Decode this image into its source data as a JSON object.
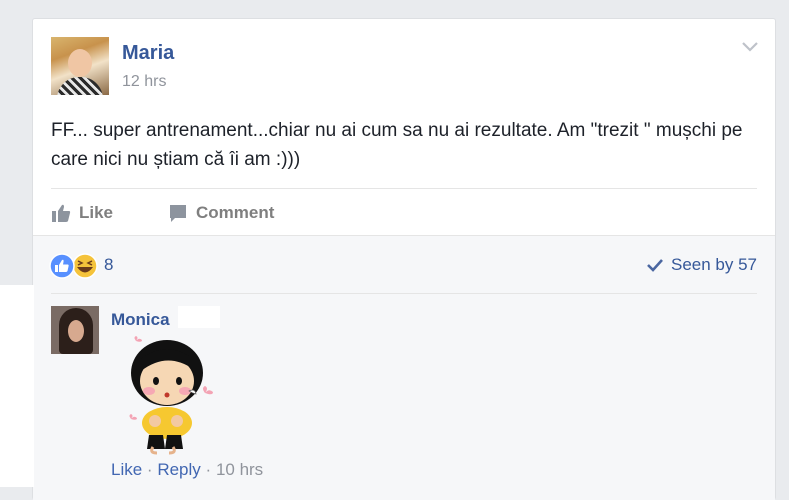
{
  "post": {
    "author": "Maria",
    "time": "12 hrs",
    "text": "FF... super antrenament...chiar nu ai cum sa nu ai rezultate. Am \"trezit \" mușchi pe care nici nu știam că îi am :)))"
  },
  "actions": {
    "like": "Like",
    "comment": "Comment"
  },
  "reactions": {
    "count": "8",
    "seen_by": "Seen by 57"
  },
  "comment": {
    "author": "Monica",
    "like": "Like",
    "separator": "·",
    "reply": "Reply",
    "time": "10 hrs"
  },
  "colors": {
    "link_blue": "#365899",
    "meta_gray": "#90949c",
    "like_blue": "#5890ff",
    "haha_yellow": "#f5c33b"
  }
}
